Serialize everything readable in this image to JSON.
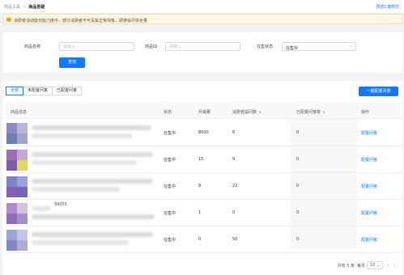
{
  "breadcrumb": {
    "parent": "商品工具",
    "current": "商品答疑"
  },
  "top_link": "预览C端样式",
  "notice": {
    "icon": "warning-icon",
    "text": "消费者活动能也能力度中，部分消费者不可见属正常现象，即使会尽快全量"
  },
  "filter": {
    "name_label": "商品名称",
    "name_placeholder": "请输入",
    "id_label": "商品ID",
    "id_placeholder": "请输入",
    "status_label": "在售状态",
    "status_value": "在售中",
    "query_button": "查询"
  },
  "tabs": [
    "全部",
    "未配置问答",
    "已配置问答"
  ],
  "active_tab": "全部",
  "batch_button": "一键配置问答",
  "table": {
    "headers": {
      "product": "商品信息",
      "status": "状态",
      "sales": "月销量",
      "questions": "消费者提问数",
      "configured": "已配置问答数",
      "action": "操作"
    },
    "rows": [
      {
        "id_text": "",
        "status": "在售中",
        "sales": "8000",
        "questions": "6",
        "configured": "0",
        "action": "配置问答"
      },
      {
        "id_text": "",
        "status": "在售中",
        "sales": "15",
        "questions": "9",
        "configured": "0",
        "action": "配置问答"
      },
      {
        "id_text": "",
        "status": "在售中",
        "sales": "9",
        "questions": "22",
        "configured": "0",
        "action": "配置问答"
      },
      {
        "id_text": "99055",
        "status": "在售中",
        "sales": "1",
        "questions": "0",
        "configured": "0",
        "action": "配置问答"
      },
      {
        "id_text": "",
        "status": "在售中",
        "sales": "0",
        "questions": "50",
        "configured": "0",
        "action": "配置问答"
      }
    ]
  },
  "pagination": {
    "total": "共有 5 条",
    "per_page_label": "每页",
    "page_size": "10"
  },
  "colors": {
    "primary": "#1677ff",
    "notice_bg": "#fff7e6",
    "warning": "#fa9d14"
  }
}
